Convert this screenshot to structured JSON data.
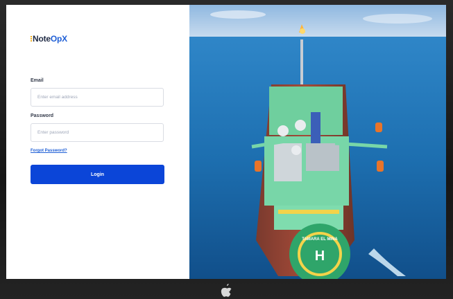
{
  "brand": {
    "logo_prefix": "Note",
    "logo_accent": "OpX"
  },
  "form": {
    "email_label": "Email",
    "email_placeholder": "Enter email address",
    "password_label": "Password",
    "password_placeholder": "Enter password",
    "forgot_link": "Forgot Password?",
    "login_button": "Login"
  },
  "hero": {
    "ship_name": "TAMARA EL MINA",
    "helipad_letter": "H"
  },
  "colors": {
    "accent": "#0b45d8",
    "link": "#1f5fd6",
    "sea": "#1d6fb0"
  },
  "icons": {
    "device_logo": "apple-logo-icon"
  }
}
